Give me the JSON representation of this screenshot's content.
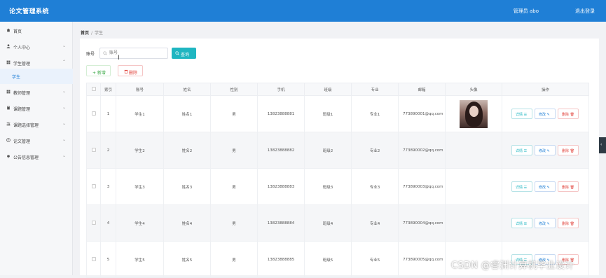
{
  "header": {
    "app_title": "论文管理系统",
    "user_info": "管理员 abo",
    "logout": "退出登录"
  },
  "sidebar": {
    "items": [
      {
        "label": "首页",
        "icon": "home-icon",
        "chevron": ""
      },
      {
        "label": "个人中心",
        "icon": "user-icon",
        "chevron": "⌄"
      },
      {
        "label": "学生管理",
        "icon": "grid-icon",
        "chevron": "⌃"
      },
      {
        "label": "学生",
        "icon": "",
        "chevron": ""
      },
      {
        "label": "教师管理",
        "icon": "grid-icon",
        "chevron": "⌄"
      },
      {
        "label": "课题管理",
        "icon": "book-icon",
        "chevron": "⌄"
      },
      {
        "label": "课题选择管理",
        "icon": "sliders-icon",
        "chevron": "⌄"
      },
      {
        "label": "论文管理",
        "icon": "document-icon",
        "chevron": "⌄"
      },
      {
        "label": "公告信息管理",
        "icon": "bell-icon",
        "chevron": "⌄"
      }
    ]
  },
  "breadcrumb": {
    "home": "首页",
    "separator": "/",
    "current": "学生"
  },
  "search": {
    "label": "账号",
    "placeholder": "账号",
    "button": "查询"
  },
  "actions": {
    "add": "+ 新增",
    "delete": "删除"
  },
  "table": {
    "columns": [
      "",
      "索引",
      "账号",
      "姓名",
      "性别",
      "手机",
      "班级",
      "专业",
      "邮箱",
      "头像",
      "操作"
    ],
    "rows": [
      {
        "index": "1",
        "account": "学生1",
        "name": "姓名1",
        "gender": "男",
        "phone": "13823888881",
        "class": "班级1",
        "major": "专业1",
        "email": "773890001@qq.com",
        "has_avatar": true
      },
      {
        "index": "2",
        "account": "学生2",
        "name": "姓名2",
        "gender": "男",
        "phone": "13823888882",
        "class": "班级2",
        "major": "专业2",
        "email": "773890002@qq.com",
        "has_avatar": false
      },
      {
        "index": "3",
        "account": "学生3",
        "name": "姓名3",
        "gender": "男",
        "phone": "13823888883",
        "class": "班级3",
        "major": "专业3",
        "email": "773890003@qq.com",
        "has_avatar": false
      },
      {
        "index": "4",
        "account": "学生4",
        "name": "姓名4",
        "gender": "男",
        "phone": "13823888884",
        "class": "班级4",
        "major": "专业4",
        "email": "773890004@qq.com",
        "has_avatar": false
      },
      {
        "index": "5",
        "account": "学生5",
        "name": "姓名5",
        "gender": "男",
        "phone": "13823888885",
        "class": "班级5",
        "major": "专业5",
        "email": "773890005@qq.com",
        "has_avatar": false
      }
    ],
    "row_actions": {
      "detail": "详情 ☰",
      "edit": "修改 ✎",
      "delete": "删除 🗑"
    }
  },
  "side_tab": "‹",
  "watermark": "CSDN @睿渊计算机毕业设计",
  "colors": {
    "header": "#1f7fd6",
    "search_button": "#1fb6c1",
    "delete": "#e2463f",
    "add": "#39a845"
  }
}
